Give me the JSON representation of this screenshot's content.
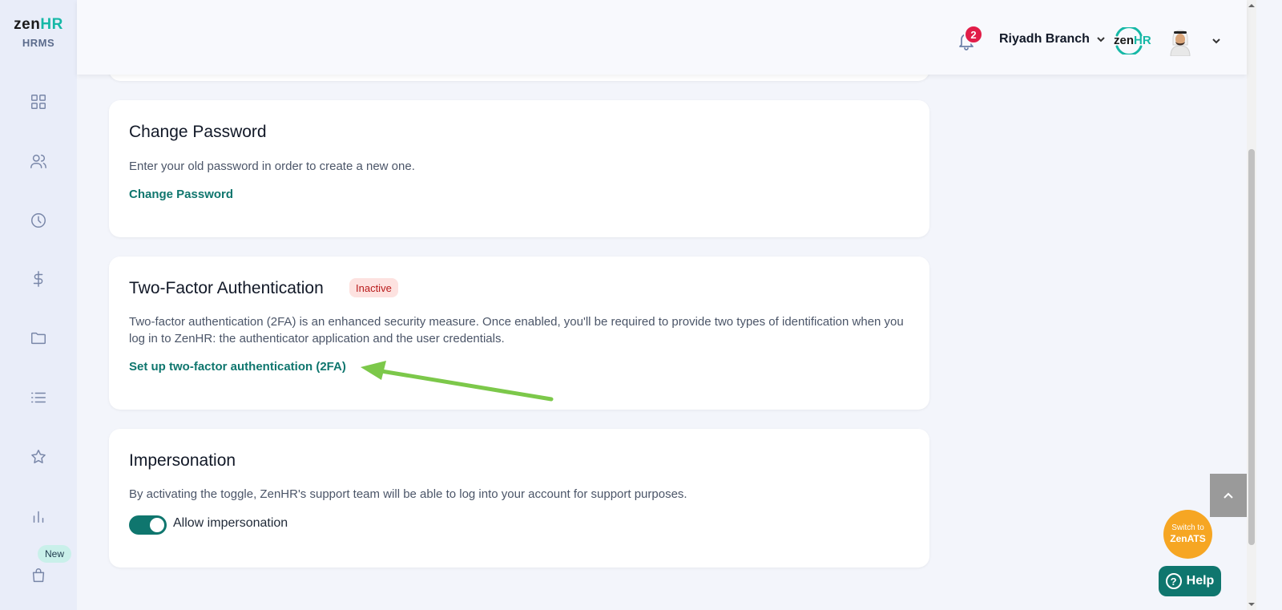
{
  "app": {
    "logo_zen": "zen",
    "logo_hr": "HR",
    "logo_sub": "HRMS"
  },
  "sidebar": {
    "items": [
      {
        "name": "dashboard-icon"
      },
      {
        "name": "people-icon"
      },
      {
        "name": "clock-icon"
      },
      {
        "name": "dollar-icon"
      },
      {
        "name": "folder-icon"
      },
      {
        "name": "list-icon"
      },
      {
        "name": "star-icon"
      },
      {
        "name": "chart-icon"
      },
      {
        "name": "shopping-bag-icon"
      }
    ],
    "new_badge": "New"
  },
  "header": {
    "notification_count": "2",
    "branch": "Riyadh Branch",
    "company_logo_zen": "zen",
    "company_logo_hr": "HR"
  },
  "change_password": {
    "title": "Change Password",
    "description": "Enter your old password in order to create a new one.",
    "link": "Change Password"
  },
  "two_factor": {
    "title": "Two-Factor Authentication",
    "status": "Inactive",
    "description": "Two-factor authentication (2FA) is an enhanced security measure. Once enabled, you'll be required to provide two types of identification when you log in to ZenHR: the authenticator application and the user credentials.",
    "link": "Set up two-factor authentication (2FA)"
  },
  "impersonation": {
    "title": "Impersonation",
    "description": "By activating the toggle, ZenHR's support team will be able to log into your account for support purposes.",
    "toggle_label": "Allow impersonation",
    "toggle_on": true
  },
  "floating": {
    "switch_line1": "Switch to",
    "switch_line2": "ZenATS",
    "help": "Help"
  },
  "colors": {
    "accent": "#0f766e",
    "brand_teal": "#16b8a6",
    "badge_red": "#e11d48",
    "switch_orange": "#f6a623",
    "annotation_arrow": "#7cc84a"
  }
}
